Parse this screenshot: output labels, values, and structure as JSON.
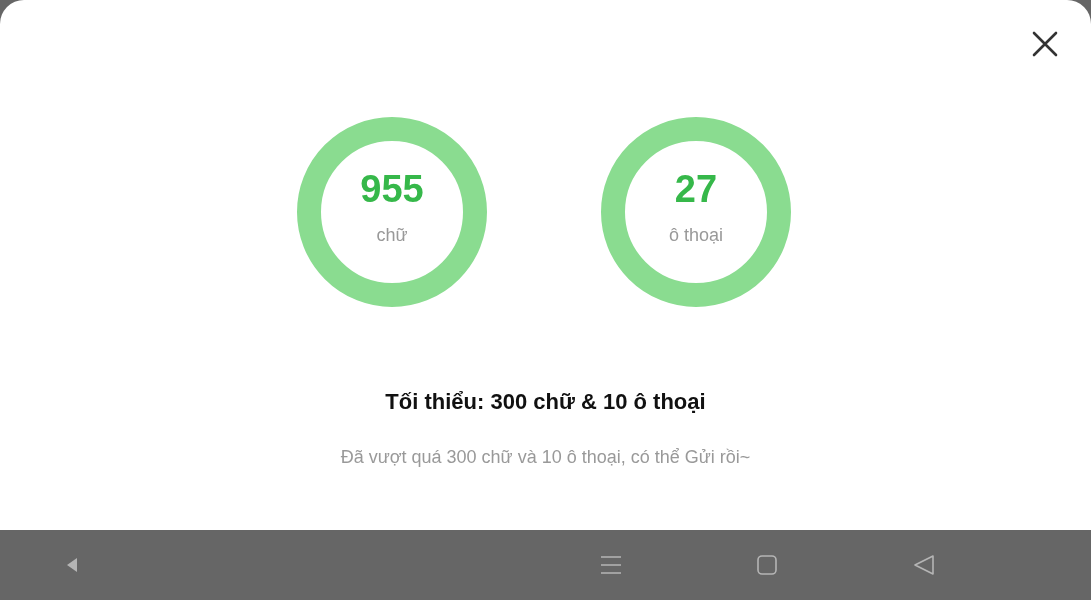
{
  "counters": [
    {
      "value": "955",
      "unit": "chữ"
    },
    {
      "value": "27",
      "unit": "ô thoại"
    }
  ],
  "requirement": "Tối thiểu: 300 chữ & 10 ô thoại",
  "message": "Đã vượt quá 300 chữ và 10 ô thoại, có thể Gửi rồi~"
}
